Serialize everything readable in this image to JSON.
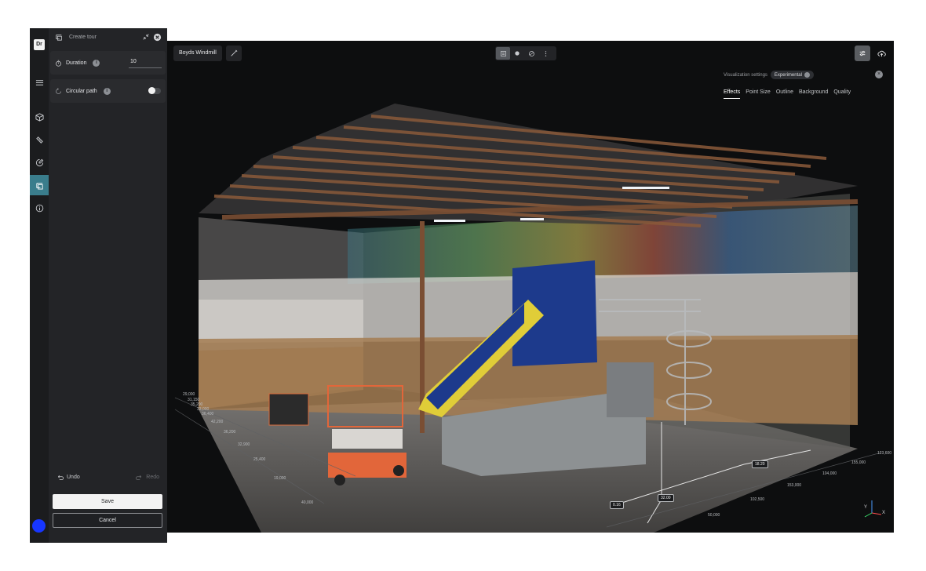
{
  "rail": {
    "logo_text": "Dr",
    "items": [
      {
        "name": "menu-icon"
      },
      {
        "name": "cube-icon"
      },
      {
        "name": "ruler-icon"
      },
      {
        "name": "annotate-icon"
      },
      {
        "name": "tour-icon"
      },
      {
        "name": "info-icon"
      }
    ]
  },
  "panel": {
    "title": "Create tour",
    "duration_label": "Duration",
    "duration_value": "10",
    "circular_label": "Circular path",
    "circular_enabled": false,
    "info_glyph": "i",
    "undo_label": "Undo",
    "redo_label": "Redo",
    "save_label": "Save",
    "cancel_label": "Cancel"
  },
  "toolbar": {
    "project_name": "Boyds Windmill"
  },
  "visualization": {
    "header": "Visualization settings",
    "badge": "Experimental",
    "close_glyph": "×",
    "tabs": [
      "Effects",
      "Point Size",
      "Outline",
      "Background",
      "Quality"
    ],
    "active_tab": "Effects"
  },
  "scene": {
    "axis_ticks_left": [
      "29,000",
      "31,150",
      "35,200",
      "33,000",
      "36,400",
      "42,200",
      "36,200",
      "32,900",
      "25,400",
      "19,000",
      "40,000"
    ],
    "axis_ticks_right": [
      "123,600",
      "155,000",
      "104,000",
      "153,000",
      "102,500",
      "50,000"
    ],
    "measurements": [
      "18.20",
      "0.16",
      "32.00"
    ],
    "gizmo_labels": {
      "x": "X",
      "y": "Y",
      "z": "Z"
    }
  },
  "colors": {
    "accent": "#3a7d8c",
    "avatar": "#1736ff",
    "panel_bg": "#232427",
    "viewport_bg": "#0d0e0f"
  }
}
